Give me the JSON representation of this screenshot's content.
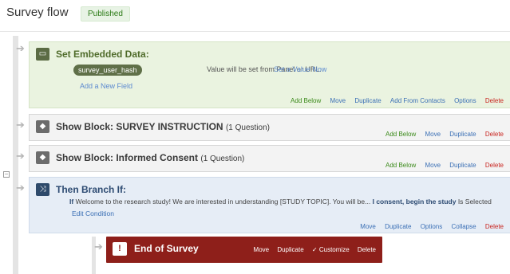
{
  "header": {
    "title": "Survey flow",
    "status_badge": "Published"
  },
  "elements": {
    "embedded": {
      "title": "Set Embedded Data:",
      "field_name": "survey_user_hash",
      "field_value_text": "Value will be set from Panel or URL.",
      "set_value_link": "Set a Value Now",
      "add_field_link": "Add a New Field",
      "actions": [
        "Add Below",
        "Move",
        "Duplicate",
        "Add From Contacts",
        "Options",
        "Delete"
      ]
    },
    "block1": {
      "title": "Show Block: SURVEY INSTRUCTION",
      "subtitle": "(1 Question)",
      "actions": [
        "Add Below",
        "Move",
        "Duplicate",
        "Delete"
      ]
    },
    "block2": {
      "title": "Show Block: Informed Consent",
      "subtitle": "(1 Question)",
      "actions": [
        "Add Below",
        "Move",
        "Duplicate",
        "Delete"
      ]
    },
    "branch": {
      "title": "Then Branch If:",
      "cond_if": "If",
      "cond_question": "Welcome to the research study!   We are interested in understanding [STUDY TOPIC].  You will be...",
      "cond_choice": "I consent, begin the study",
      "cond_operator": "Is Selected",
      "edit_condition": "Edit Condition",
      "actions": [
        "Move",
        "Duplicate",
        "Options",
        "Collapse",
        "Delete"
      ]
    },
    "end_of_survey": {
      "title": "End of Survey",
      "actions": [
        "Move",
        "Duplicate",
        "✓ Customize",
        "Delete"
      ]
    }
  },
  "icons": {
    "embedded": "embedded-data-icon",
    "block": "block-icon",
    "branch": "branch-icon",
    "end": "warning-icon",
    "arrow": "flow-arrow-icon"
  },
  "colors": {
    "embedded_bg": "#eaf3e0",
    "block_bg": "#f3f3f3",
    "branch_bg": "#e6edf6",
    "end_bg": "#8e1f1a",
    "delete": "#c8231e",
    "link": "#3a6fb5"
  }
}
